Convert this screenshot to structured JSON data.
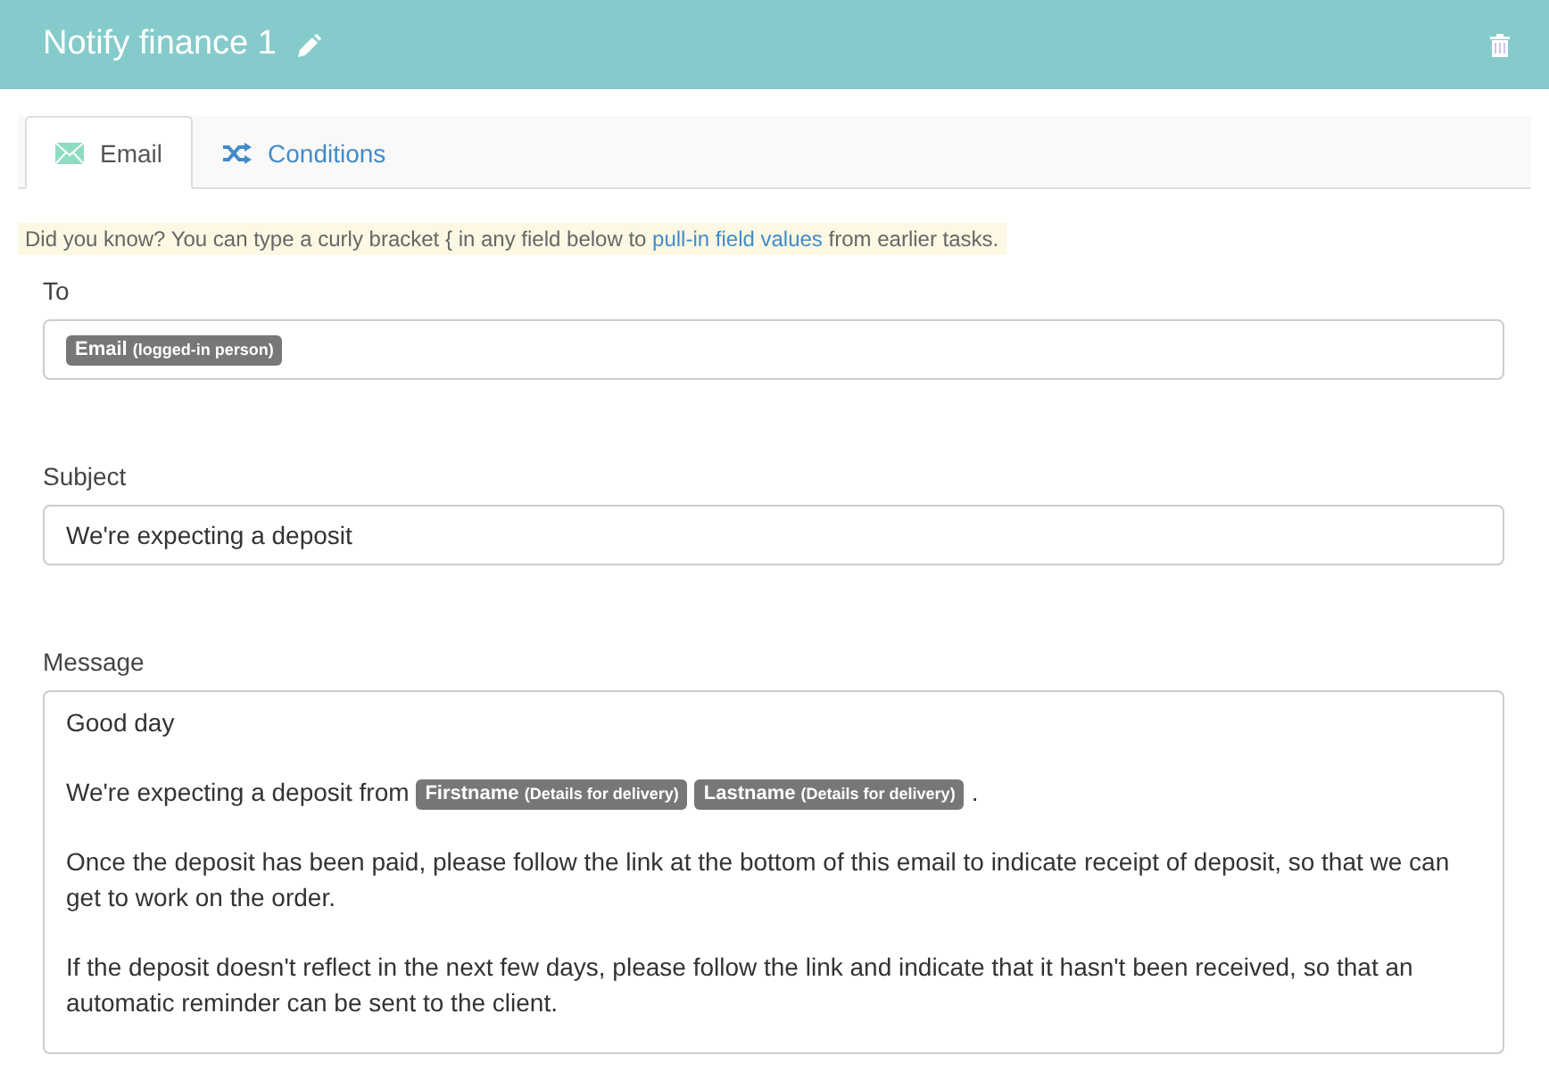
{
  "header": {
    "title": "Notify finance 1"
  },
  "tabs": [
    {
      "label": "Email",
      "selected": true,
      "kind": "email"
    },
    {
      "label": "Conditions",
      "selected": false,
      "kind": "conditions"
    }
  ],
  "tip": {
    "before": "Did you know? You can type a curly bracket { in any field below to ",
    "link": "pull-in field values",
    "after": " from earlier tasks."
  },
  "to": {
    "label": "To",
    "tokens": [
      {
        "name": "Email",
        "source": "(logged-in person)"
      }
    ]
  },
  "subject": {
    "label": "Subject",
    "value": "We're expecting a deposit"
  },
  "message": {
    "label": "Message",
    "paragraphs": [
      [
        {
          "kind": "text",
          "text": "Good day"
        }
      ],
      [
        {
          "kind": "text",
          "text": "We're expecting a deposit from "
        },
        {
          "kind": "token",
          "name": "Firstname",
          "source": "(Details for delivery)"
        },
        {
          "kind": "token",
          "name": "Lastname",
          "source": "(Details for delivery)"
        },
        {
          "kind": "text",
          "text": "."
        }
      ],
      [
        {
          "kind": "text",
          "text": "Once the deposit has been paid, please follow the link at the bottom of this email to indicate receipt of deposit, so that we can get to work on the order."
        }
      ],
      [
        {
          "kind": "text",
          "text": "If the deposit doesn't reflect in the next few days, please follow the link and indicate that it hasn't been received, so that an automatic reminder can be sent to the client."
        }
      ]
    ]
  }
}
